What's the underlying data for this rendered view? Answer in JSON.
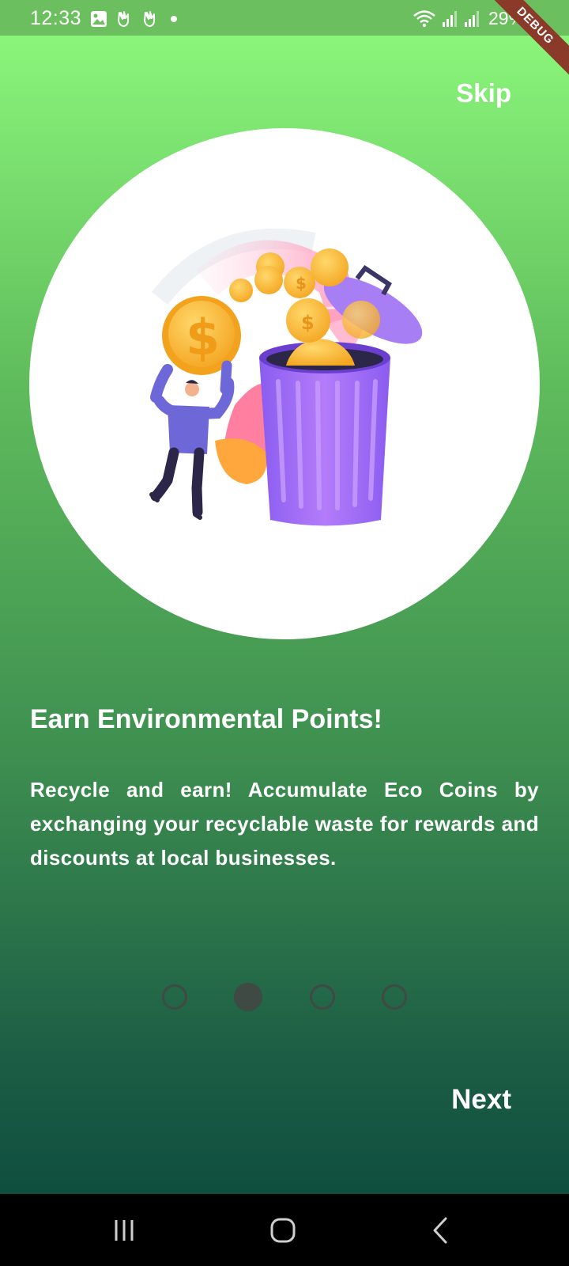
{
  "status_bar": {
    "time": "12:33",
    "left_icons": [
      "image-icon",
      "gesture-icon",
      "gesture-icon",
      "dot-icon"
    ],
    "right_icons": [
      "wifi-icon",
      "signal-icon",
      "signal-icon"
    ],
    "battery": "29%"
  },
  "debug_banner": "DEBUG",
  "header": {
    "skip_label": "Skip"
  },
  "onboarding": {
    "illustration": "person-throwing-coins-into-trash-can-illustration",
    "title": "Earn Environmental Points!",
    "description": "Recycle and earn! Accumulate Eco Coins by exchanging your recyclable waste for rewards and discounts at local businesses.",
    "page_count": 4,
    "current_page": 2
  },
  "footer": {
    "next_label": "Next"
  },
  "nav_bar": {
    "buttons": [
      "recent-apps-icon",
      "home-icon",
      "back-icon"
    ]
  },
  "colors": {
    "status_bar": "#6cbf5e",
    "gradient_top": "#8af57a",
    "gradient_bottom": "#0f4e3e",
    "indicator": "#3f4a44",
    "text": "#ffffff",
    "debug_ribbon": "#8b3a2a"
  }
}
